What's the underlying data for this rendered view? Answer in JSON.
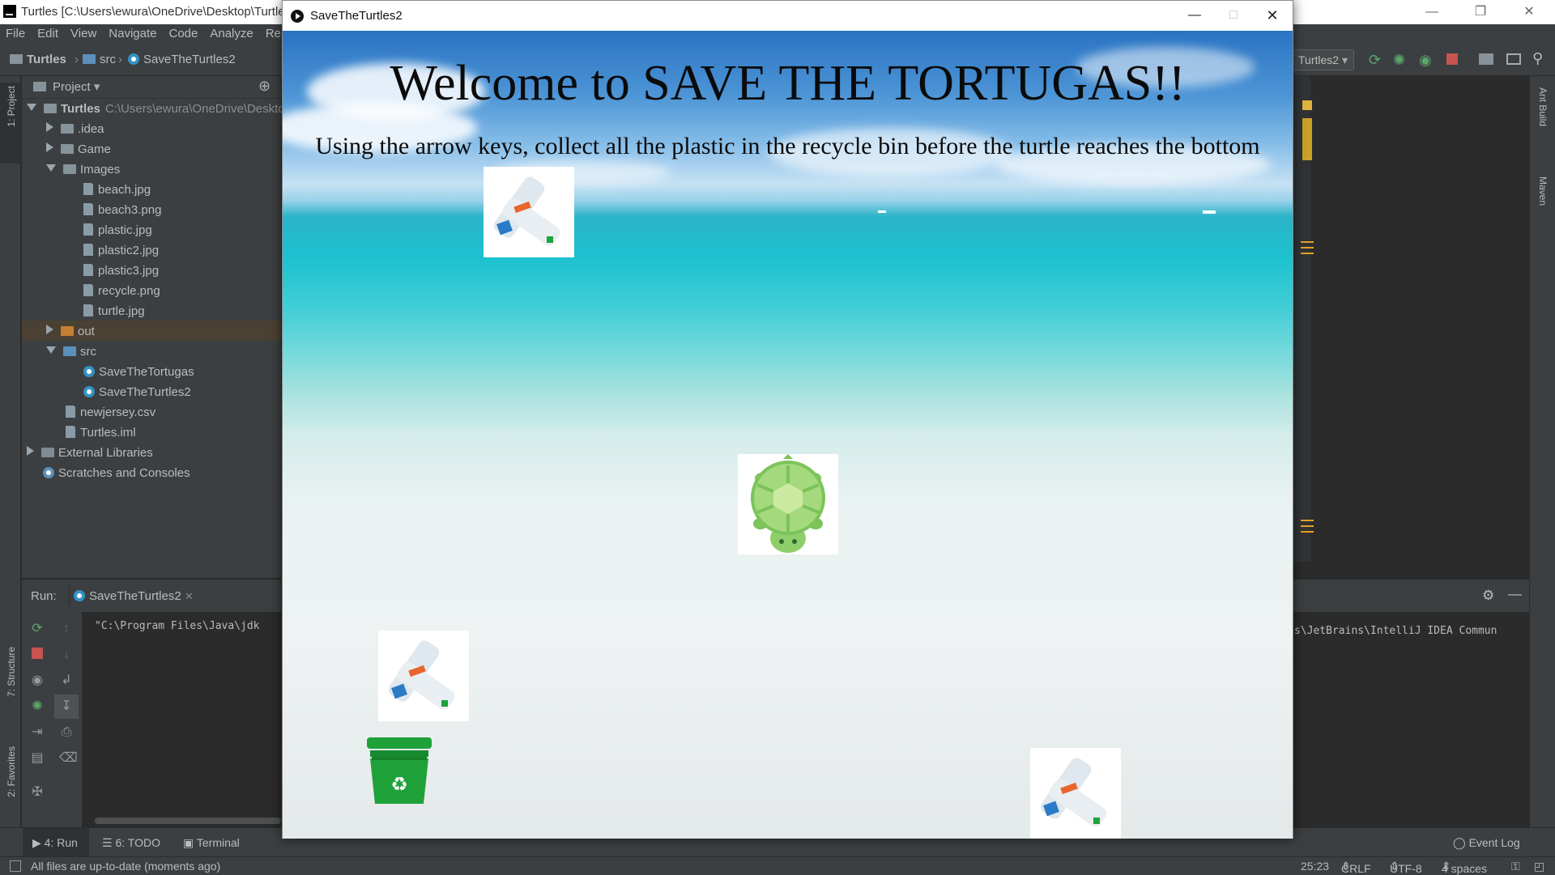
{
  "ide": {
    "title": "Turtles [C:\\Users\\ewura\\OneDrive\\Desktop\\Turtles]",
    "menu": [
      "File",
      "Edit",
      "View",
      "Navigate",
      "Code",
      "Analyze",
      "Re"
    ],
    "breadcrumbs": [
      "Turtles",
      "src",
      "SaveTheTurtles2"
    ],
    "run_config": "Turtles2",
    "left_strip": [
      "1: Project",
      "7: Structure",
      "2: Favorites"
    ],
    "right_strip": [
      "Ant Build",
      "Maven"
    ],
    "project": {
      "header": "Project",
      "root": "Turtles",
      "root_path": "C:\\Users\\ewura\\OneDrive\\Deskto",
      "items": [
        ".idea",
        "Game",
        "Images",
        "beach.jpg",
        "beach3.png",
        "plastic.jpg",
        "plastic2.jpg",
        "plastic3.jpg",
        "recycle.png",
        "turtle.jpg",
        "out",
        "src",
        "SaveTheTortugas",
        "SaveTheTurtles2",
        "newjersey.csv",
        "Turtles.iml",
        "External Libraries",
        "Scratches and Consoles"
      ]
    },
    "run": {
      "label": "Run:",
      "tab": "SaveTheTurtles2",
      "console_left": "\"C:\\Program Files\\Java\\jdk",
      "console_right": "s\\JetBrains\\IntelliJ IDEA Commun"
    },
    "bottom_tabs": [
      "4: Run",
      "6: TODO",
      "Terminal"
    ],
    "event_log": "Event Log",
    "status": {
      "message": "All files are up-to-date (moments ago)",
      "position": "25:23",
      "line_sep": "CRLF",
      "encoding": "UTF-8",
      "indent": "4 spaces"
    }
  },
  "game": {
    "title": "SaveTheTurtles2",
    "welcome": "Welcome to SAVE THE TORTUGAS!!",
    "instructions": "Using the arrow keys, collect all the plastic in the recycle bin before the turtle reaches the bottom"
  },
  "colors": {
    "ide_bg": "#3c3f41",
    "editor_bg": "#2b2b2b",
    "bin": "#1fa139",
    "turtle": "#8fcf6b"
  }
}
